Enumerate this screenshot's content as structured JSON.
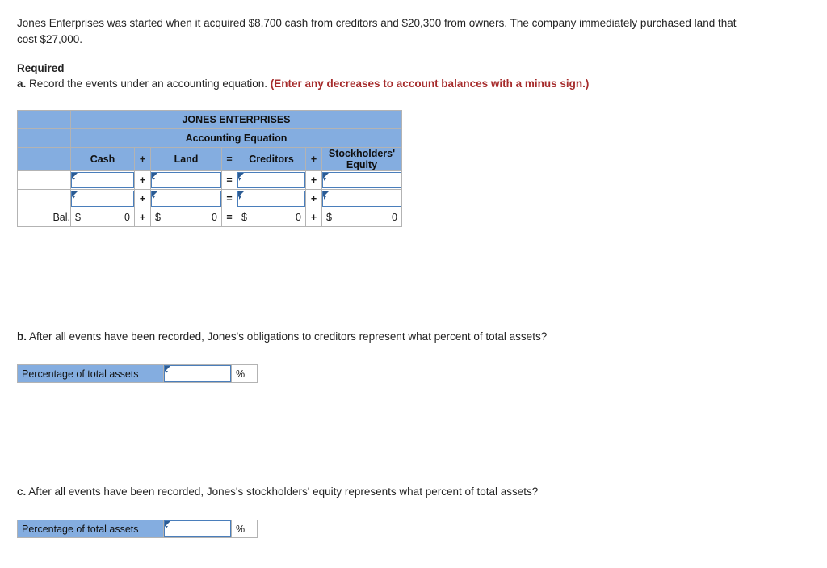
{
  "intro": {
    "text": "Jones Enterprises was started when it acquired $8,700 cash from creditors and $20,300 from owners. The company immediately purchased land that cost $27,000."
  },
  "required": {
    "heading": "Required",
    "a_letter": "a.",
    "a_text": " Record the events under an accounting equation. ",
    "a_note": "(Enter any decreases to account balances with a minus sign.)"
  },
  "equation_table": {
    "company_title": "JONES ENTERPRISES",
    "subtitle": "Accounting Equation",
    "columns": {
      "row_label": "",
      "cash": "Cash",
      "op1": "+",
      "land": "Land",
      "equals": "=",
      "creditors": "Creditors",
      "op2": "+",
      "stockholders_equity": "Stockholders' Equity"
    },
    "entry_rows": [
      {
        "label": "",
        "cash": "",
        "op1": "+",
        "land": "",
        "equals": "=",
        "creditors": "",
        "op2": "+",
        "equity": ""
      },
      {
        "label": "",
        "cash": "",
        "op1": "+",
        "land": "",
        "equals": "=",
        "creditors": "",
        "op2": "+",
        "equity": ""
      }
    ],
    "balance_row": {
      "label": "Bal.",
      "cash_symbol": "$",
      "cash_value": "0",
      "op1": "+",
      "land_symbol": "$",
      "land_value": "0",
      "equals": "=",
      "creditors_symbol": "$",
      "creditors_value": "0",
      "op2": "+",
      "equity_symbol": "$",
      "equity_value": "0"
    }
  },
  "question_b": {
    "letter": "b.",
    "text": " After all events have been recorded, Jones's obligations to creditors represent what percent of total assets?",
    "answer_label": "Percentage of total assets",
    "answer_value": "",
    "unit": "%"
  },
  "question_c": {
    "letter": "c.",
    "text": " After all events have been recorded, Jones's stockholders' equity represents what percent of total assets?",
    "answer_label": "Percentage of total assets",
    "answer_value": "",
    "unit": "%"
  },
  "colors": {
    "header_blue": "#84ADE0",
    "field_border_blue": "#4a7ebb",
    "marker_blue": "#2c5c94",
    "note_red": "#a62c2c",
    "balance_underline": "#11204a",
    "grid_gray": "#b3b3b3"
  }
}
